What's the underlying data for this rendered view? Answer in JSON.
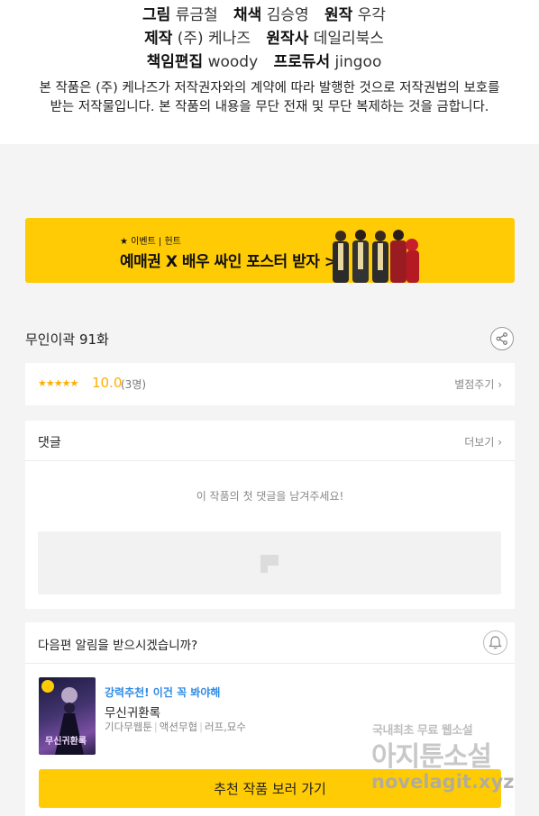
{
  "credits": {
    "row1": [
      {
        "k": "그림",
        "v": "류금철"
      },
      {
        "k": "채색",
        "v": "김승영"
      },
      {
        "k": "원작",
        "v": "우각"
      }
    ],
    "row2": [
      {
        "k": "제작",
        "v": "(주) 케나즈"
      },
      {
        "k": "원작사",
        "v": "데일리북스"
      }
    ],
    "row3": [
      {
        "k": "책임편집",
        "v": "woody"
      },
      {
        "k": "프로듀서",
        "v": "jingoo"
      }
    ],
    "notice_line1": "본 작품은 (주) 케나즈가 저작권자와의 계약에 따라 발행한 것으로 저작권법의 보호를",
    "notice_line2": "받는 저작물입니다. 본 작품의 내용을 무단 전재 및 무단 복제하는 것을 금합니다."
  },
  "banner": {
    "small": "★ 이벤트 | 헌트",
    "big": "예매권 X 배우 싸인 포스터 받자 >"
  },
  "episode": {
    "title": "무인이곽 91화",
    "share_icon": "share-icon"
  },
  "rating": {
    "stars": "★★★★★",
    "score": "10.0",
    "count": "(3명)",
    "rate_link": "별점주기 ›"
  },
  "comments": {
    "heading": "댓글",
    "more_link": "더보기 ›",
    "empty_message": "이 작품의 첫 댓글을 남겨주세요!"
  },
  "next": {
    "question": "다음편 알림을 받으시겠습니까?",
    "bell_icon": "bell-icon",
    "rec_tag": "강력추천! 이건 꼭 봐야해",
    "rec_title": "무신귀환록",
    "rec_meta": [
      "기다무웹툰",
      "액션무협",
      "러프,묘수"
    ],
    "button_label": "추천 작품 보러 가기",
    "thumb_text": "무신귀환록"
  },
  "watermark": {
    "line1": "국내최초 무료 웹소설",
    "line2": "아지툰소설",
    "line3": "novelagit.xyz"
  },
  "colors": {
    "accent_yellow": "#ffcb05",
    "star_orange": "#ffae00",
    "link_blue": "#2e8be6"
  }
}
